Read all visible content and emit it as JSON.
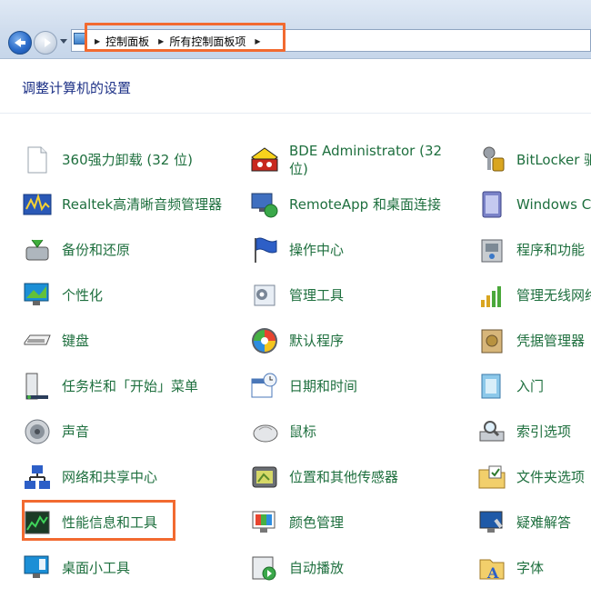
{
  "address": {
    "crumbs": [
      "控制面板",
      "所有控制面板项"
    ]
  },
  "page": {
    "heading": "调整计算机的设置"
  },
  "items": [
    {
      "label": "360强力卸载 (32 位)",
      "icon": "blank-document-icon"
    },
    {
      "label": "BDE Administrator (32 位)",
      "icon": "bde-administrator-icon"
    },
    {
      "label": "BitLocker 驱",
      "icon": "bitlocker-keys-icon"
    },
    {
      "label": "Realtek高清晰音频管理器",
      "icon": "realtek-audio-icon"
    },
    {
      "label": "RemoteApp 和桌面连接",
      "icon": "remoteapp-icon"
    },
    {
      "label": "Windows C",
      "icon": "windows-cardspace-icon"
    },
    {
      "label": "备份和还原",
      "icon": "backup-restore-icon"
    },
    {
      "label": "操作中心",
      "icon": "action-center-flag-icon"
    },
    {
      "label": "程序和功能",
      "icon": "programs-features-icon"
    },
    {
      "label": "个性化",
      "icon": "personalization-icon"
    },
    {
      "label": "管理工具",
      "icon": "admin-tools-icon"
    },
    {
      "label": "管理无线网络",
      "icon": "wireless-network-icon"
    },
    {
      "label": "键盘",
      "icon": "keyboard-icon"
    },
    {
      "label": "默认程序",
      "icon": "default-programs-icon"
    },
    {
      "label": "凭据管理器",
      "icon": "credential-manager-icon"
    },
    {
      "label": "任务栏和「开始」菜单",
      "icon": "taskbar-start-menu-icon"
    },
    {
      "label": "日期和时间",
      "icon": "date-time-icon"
    },
    {
      "label": "入门",
      "icon": "getting-started-icon"
    },
    {
      "label": "声音",
      "icon": "speaker-icon"
    },
    {
      "label": "鼠标",
      "icon": "mouse-icon"
    },
    {
      "label": "索引选项",
      "icon": "indexing-options-icon"
    },
    {
      "label": "网络和共享中心",
      "icon": "network-sharing-icon"
    },
    {
      "label": "位置和其他传感器",
      "icon": "location-sensors-icon"
    },
    {
      "label": "文件夹选项",
      "icon": "folder-options-icon"
    },
    {
      "label": "性能信息和工具",
      "icon": "performance-icon"
    },
    {
      "label": "颜色管理",
      "icon": "color-management-icon"
    },
    {
      "label": "疑难解答",
      "icon": "troubleshooting-icon"
    },
    {
      "label": "桌面小工具",
      "icon": "desktop-gadgets-icon"
    },
    {
      "label": "自动播放",
      "icon": "autoplay-icon"
    },
    {
      "label": "字体",
      "icon": "fonts-icon"
    }
  ]
}
